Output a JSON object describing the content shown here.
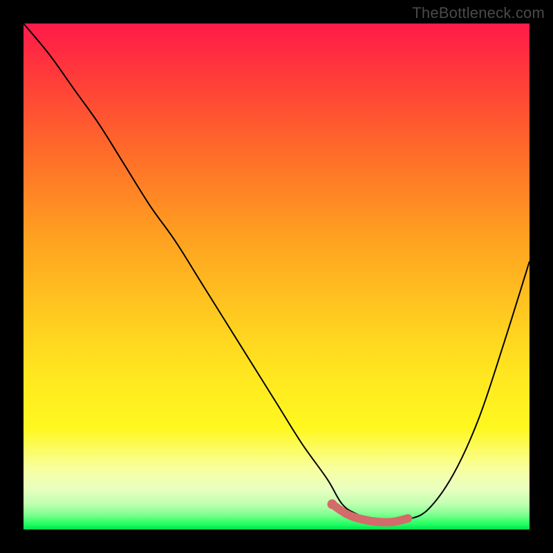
{
  "attribution": "TheBottleneck.com",
  "colors": {
    "curve": "#000000",
    "accent": "#d46a6a",
    "gradient_top": "#ff1a4a",
    "gradient_bottom": "#00e050"
  },
  "chart_data": {
    "type": "line",
    "title": "",
    "xlabel": "",
    "ylabel": "",
    "xlim": [
      0,
      100
    ],
    "ylim": [
      0,
      100
    ],
    "grid": false,
    "series": [
      {
        "name": "bottleneck-curve",
        "x": [
          0,
          5,
          10,
          15,
          20,
          25,
          30,
          35,
          40,
          45,
          50,
          55,
          60,
          63,
          66,
          70,
          73,
          76,
          80,
          85,
          90,
          95,
          100
        ],
        "y": [
          100,
          94,
          87,
          80,
          72,
          64,
          57,
          49,
          41,
          33,
          25,
          17,
          10,
          5,
          3,
          1.5,
          1.5,
          2,
          4,
          11,
          22,
          37,
          53
        ]
      },
      {
        "name": "optimal-range-accent",
        "x": [
          61,
          64,
          67,
          70,
          73,
          76
        ],
        "y": [
          5,
          3,
          2,
          1.5,
          1.5,
          2.2
        ]
      }
    ],
    "annotations": []
  }
}
